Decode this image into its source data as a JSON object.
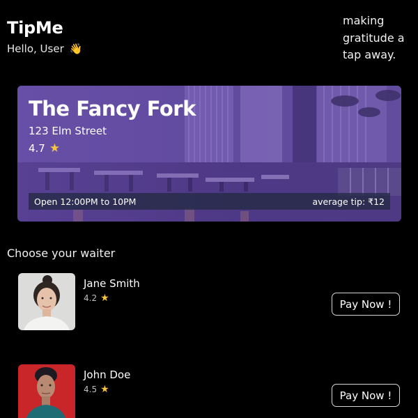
{
  "header": {
    "app_title": "TipMe",
    "greeting": "Hello, User",
    "greeting_icon": "waving-hand-icon",
    "tagline_lines": [
      "making",
      "gratitude a",
      "tap away."
    ]
  },
  "restaurant": {
    "name": "The Fancy Fork",
    "address": "123 Elm Street",
    "rating": "4.7",
    "hours": "Open 12:00PM to 10PM",
    "average_tip": "average tip: ₹12"
  },
  "section": {
    "title": "Choose your waiter"
  },
  "waiters": [
    {
      "name": "Jane Smith",
      "rating": "4.2",
      "button_label": "Pay Now !"
    },
    {
      "name": "John Doe",
      "rating": "4.5",
      "button_label": "Pay Now !"
    }
  ],
  "colors": {
    "background": "#000000",
    "banner_purple": "#5e4799",
    "star": "#f6c343",
    "button_border": "#d8d8d8"
  }
}
